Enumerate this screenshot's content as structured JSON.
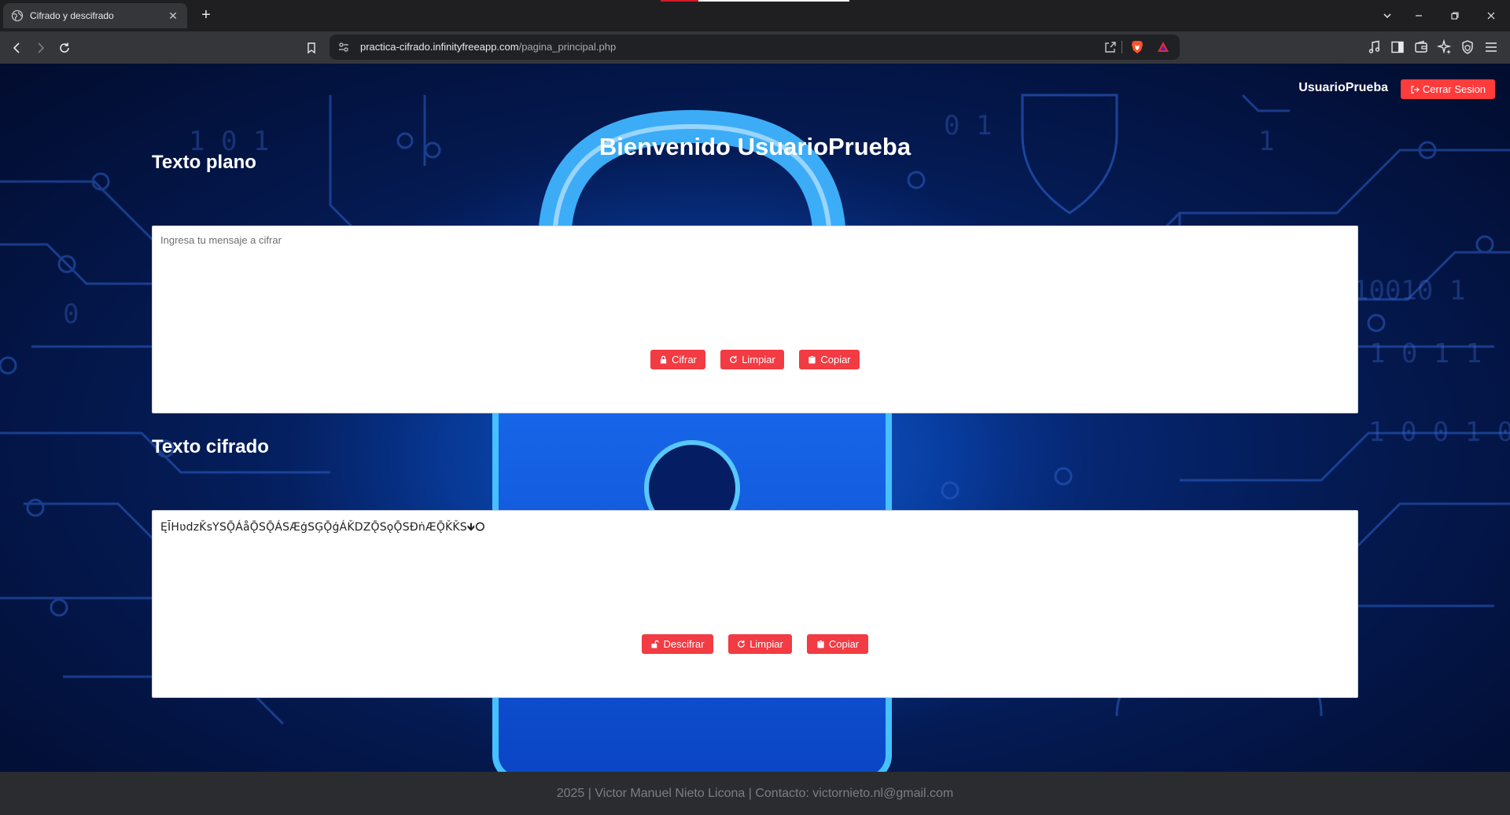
{
  "browser": {
    "tab_title": "Cifrado y descifrado",
    "new_tab_label": "+",
    "url_host": "practica-cifrado.infinityfreeapp.com",
    "url_path": "/pagina_principal.php"
  },
  "header": {
    "username": "UsuarioPrueba",
    "logout_label": "Cerrar Sesion"
  },
  "main": {
    "welcome": "Bienvenido UsuarioPrueba",
    "plain": {
      "title": "Texto plano",
      "placeholder": "Ingresa tu mensaje a cifrar",
      "value": "",
      "buttons": {
        "encrypt": "Cifrar",
        "clear": "Limpiar",
        "copy": "Copiar"
      }
    },
    "cipher": {
      "title": "Texto cifrado",
      "value": "ĘĪHʋdzǨsYSǬÁåǬSǬÁSÆģSĢǬģÁǨDZǬSǫǬSĐṅÆǬǨǨS🡻⭘",
      "buttons": {
        "decrypt": "Descifrar",
        "clear": "Limpiar",
        "copy": "Copiar"
      }
    }
  },
  "footer": {
    "text": "2025 | Victor Manuel Nieto Licona | Contacto: victornieto.nl@gmail.com"
  },
  "colors": {
    "accent_red": "#f23b42",
    "page_bg": "#041a52",
    "footer_bg": "#2a2c30"
  }
}
